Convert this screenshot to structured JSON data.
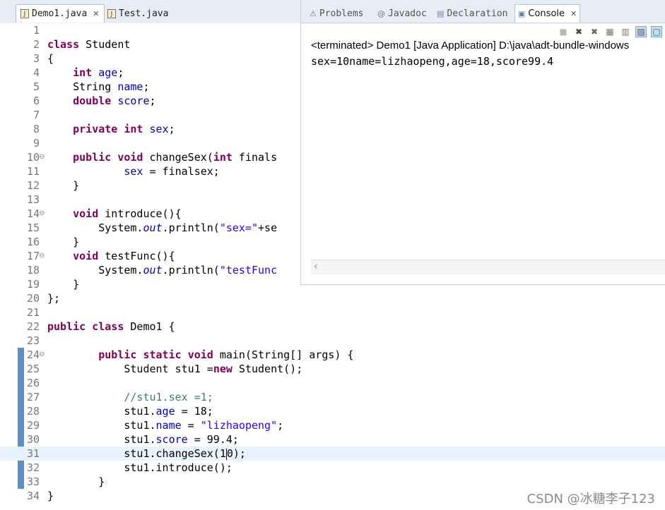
{
  "editor_tabs": [
    {
      "label": "Demo1.java",
      "active": true,
      "closable": true,
      "icon": "java-file-icon"
    },
    {
      "label": "Test.java",
      "active": false,
      "closable": false,
      "icon": "java-file-icon"
    }
  ],
  "console_tabs": [
    {
      "label": "Problems",
      "icon": "problems-icon"
    },
    {
      "label": "Javadoc",
      "icon": "javadoc-icon"
    },
    {
      "label": "Declaration",
      "icon": "declaration-icon"
    },
    {
      "label": "Console",
      "icon": "console-icon",
      "active": true
    }
  ],
  "console": {
    "status": "<terminated> Demo1 [Java Application] D:\\java\\adt-bundle-windows",
    "output": "sex=10name=lizhaopeng,age=18,score99.4"
  },
  "code_lines": [
    {
      "n": "1",
      "t": ""
    },
    {
      "n": "2",
      "t": "class Student"
    },
    {
      "n": "3",
      "t": "{"
    },
    {
      "n": "4",
      "t": "    int age;"
    },
    {
      "n": "5",
      "t": "    String name;"
    },
    {
      "n": "6",
      "t": "    double score;"
    },
    {
      "n": "7",
      "t": ""
    },
    {
      "n": "8",
      "t": "    private int sex;"
    },
    {
      "n": "9",
      "t": ""
    },
    {
      "n": "10",
      "t": "    public void changeSex(int finals"
    },
    {
      "n": "11",
      "t": "            sex = finalsex;"
    },
    {
      "n": "12",
      "t": "    }"
    },
    {
      "n": "13",
      "t": ""
    },
    {
      "n": "14",
      "t": "    void introduce(){"
    },
    {
      "n": "15",
      "t": "        System.out.println(\"sex=\"+se"
    },
    {
      "n": "16",
      "t": "    }"
    },
    {
      "n": "17",
      "t": "    void testFunc(){"
    },
    {
      "n": "18",
      "t": "        System.out.println(\"testFunc"
    },
    {
      "n": "19",
      "t": "    }"
    },
    {
      "n": "20",
      "t": "};"
    },
    {
      "n": "21",
      "t": ""
    },
    {
      "n": "22",
      "t": "public class Demo1 {"
    },
    {
      "n": "23",
      "t": ""
    },
    {
      "n": "24",
      "t": "        public static void main(String[] args) {"
    },
    {
      "n": "25",
      "t": "            Student stu1 =new Student();"
    },
    {
      "n": "26",
      "t": ""
    },
    {
      "n": "27",
      "t": "            //stu1.sex =1;"
    },
    {
      "n": "28",
      "t": "            stu1.age = 18;"
    },
    {
      "n": "29",
      "t": "            stu1.name = \"lizhaopeng\";"
    },
    {
      "n": "30",
      "t": "            stu1.score = 99.4;"
    },
    {
      "n": "31",
      "t": "            stu1.changeSex(10);"
    },
    {
      "n": "32",
      "t": "            stu1.introduce();"
    },
    {
      "n": "33",
      "t": "        }"
    },
    {
      "n": "34",
      "t": "}"
    }
  ],
  "watermark": "CSDN @冰糖李子123",
  "colors": {
    "keyword": "#7f0055",
    "field": "#0000c0",
    "string": "#2a00ff",
    "comment": "#3f7f5f",
    "change_bar": "#5a8fc8"
  }
}
